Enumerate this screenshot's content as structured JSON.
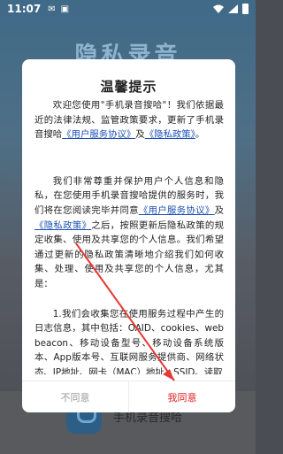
{
  "status_bar": {
    "time": "11:07"
  },
  "background_app": {
    "title": "隐私录音",
    "app_name": "手机录音搜哈"
  },
  "dialog": {
    "title": "温馨提示",
    "para1_a": "欢迎您使用\"手机录音搜哈\"！我们依据最近的法律法规、监管政策要求，更新了手机录音搜哈",
    "para1_link1": "《用户服务协议》",
    "para1_b": "及",
    "para1_link2": "《隐私政策》",
    "para1_c": "。",
    "para2_a": "我们非常尊重并保护用户个人信息和隐私，在您使用手机录音搜哈提供的服务时，我们将在您阅读完毕并同意",
    "para2_link1": "《用户服务协议》",
    "para2_b": "及",
    "para2_link2": "《隐私政策》",
    "para2_c": "之后，按照更新后隐私政策的规定收集、使用及共享您的个人信息。我们希望通过更新的隐私政策清晰地介绍我们如何收集、处理、使用及共享您的个人信息，尤其是：",
    "para3": "1.我们会收集您在使用服务过程中产生的日志信息，其中包括：OAID、cookies、web beacon、移动设备型号、移动设备系统版本、App版本号、互联网服务提供商、网络状态、IP地址、网卡（MAC）地址、SSID、读取",
    "disagree_label": "不同意",
    "agree_label": "我同意"
  }
}
